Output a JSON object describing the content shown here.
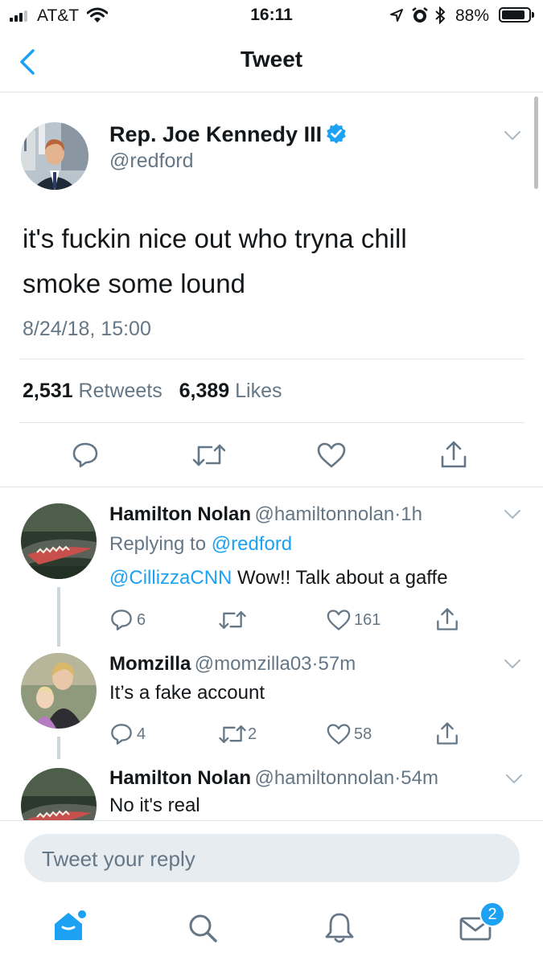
{
  "status_bar": {
    "carrier": "AT&T",
    "time": "16:11",
    "battery": "88%",
    "battery_level": 0.88,
    "icons": [
      "signal-icon",
      "wifi-icon",
      "location-arrow-icon",
      "alarm-icon",
      "bluetooth-icon",
      "battery-icon"
    ]
  },
  "header": {
    "title": "Tweet",
    "back_icon": "back-chevron-icon"
  },
  "tweet": {
    "author_name": "Rep. Joe Kennedy III",
    "handle": "@redford",
    "verified": true,
    "text_line1": "it's fuckin nice out who tryna chill",
    "text_line2": "smoke some lound",
    "timestamp": "8/24/18, 15:00",
    "retweets_count": "2,531",
    "retweets_label": "Retweets",
    "likes_count": "6,389",
    "likes_label": "Likes",
    "actions": [
      "reply-icon",
      "retweet-icon",
      "like-icon",
      "share-icon"
    ]
  },
  "replies": [
    {
      "name": "Hamilton Nolan",
      "handle": "@hamiltonnolan",
      "sep": "·",
      "time": "1h",
      "replying_prefix": "Replying to",
      "replying_to": "@redford",
      "mention": "@CillizzaCNN",
      "text": "Wow!! Talk about a gaffe",
      "reply_count": "6",
      "retweet_count": "",
      "like_count": "161"
    },
    {
      "name": "Momzilla",
      "handle": "@momzilla03",
      "sep": "·",
      "time": "57m",
      "text": "It’s a fake account",
      "reply_count": "4",
      "retweet_count": "2",
      "like_count": "58"
    },
    {
      "name": "Hamilton Nolan",
      "handle": "@hamiltonnolan",
      "sep": "·",
      "time": "54m",
      "text": "No it's real"
    }
  ],
  "composer": {
    "placeholder": "Tweet your reply"
  },
  "tab_bar": {
    "items": [
      "home-icon",
      "search-icon",
      "notifications-icon",
      "messages-icon"
    ],
    "messages_badge": "2"
  },
  "colors": {
    "accent": "#1da1f2",
    "text": "#14171a",
    "secondary_text": "#657786",
    "divider": "#e1e8ed",
    "composer_bg": "#e6ecf0"
  }
}
